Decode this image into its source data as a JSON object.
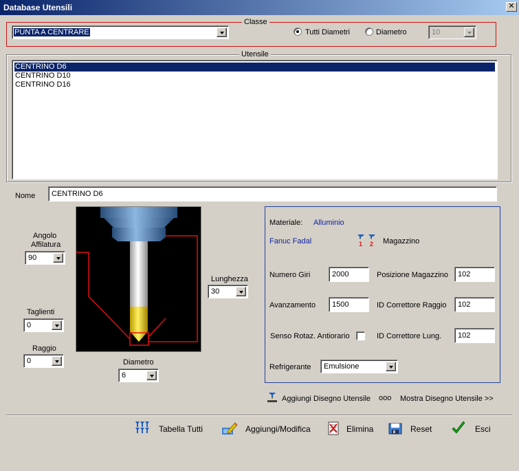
{
  "window": {
    "title": "Database Utensili",
    "close_glyph": "✕"
  },
  "classe": {
    "legend": "Classe",
    "selected": "PUNTA A CENTRARE",
    "radio_all_label": "Tutti Diametri",
    "radio_diam_label": "Diametro",
    "diam_value": "10"
  },
  "utensile": {
    "legend": "Utensile",
    "items": [
      "CENTRINO D6",
      "CENTRINO D10",
      "CENTRINO D16"
    ],
    "selected_index": 0
  },
  "nome": {
    "label": "Nome",
    "value": "CENTRINO D6"
  },
  "geometry": {
    "angolo_label_1": "Angolo",
    "angolo_label_2": "Affilatura",
    "angolo_value": "90",
    "taglienti_label": "Taglienti",
    "taglienti_value": "0",
    "raggio_label": "Raggio",
    "raggio_value": "0",
    "diametro_label": "Diametro",
    "diametro_value": "6",
    "lunghezza_label": "Lunghezza",
    "lunghezza_value": "30"
  },
  "info": {
    "materiale_label": "Materiale:",
    "materiale_value": "Alluminio",
    "machine": "Fanuc Fadal",
    "magazzino_label": "Magazzino",
    "numero_giri_label": "Numero Giri",
    "numero_giri_value": "2000",
    "posizione_label": "Posizione Magazzino",
    "posizione_value": "102",
    "avanzamento_label": "Avanzamento",
    "avanzamento_value": "1500",
    "corr_raggio_label": "ID Correttore Raggio",
    "corr_raggio_value": "102",
    "senso_label": "Senso Rotaz. Antiorario",
    "corr_lung_label": "ID Correttore Lung.",
    "corr_lung_value": "102",
    "refrigerante_label": "Refrigerante",
    "refrigerante_value": "Emulsione"
  },
  "links": {
    "aggiungi_disegno": "Aggiungi Disegno Utensile",
    "mostra_dots": "ooo",
    "mostra_disegno": "Mostra Disegno Utensile >>"
  },
  "toolbar": {
    "tabella": "Tabella Tutti",
    "aggiungi": "Aggiungi/Modifica",
    "elimina": "Elimina",
    "reset": "Reset",
    "esci": "Esci"
  },
  "colors": {
    "accent_red": "#d01010",
    "selection": "#0a246a",
    "info_blue": "#0a1fa0"
  }
}
